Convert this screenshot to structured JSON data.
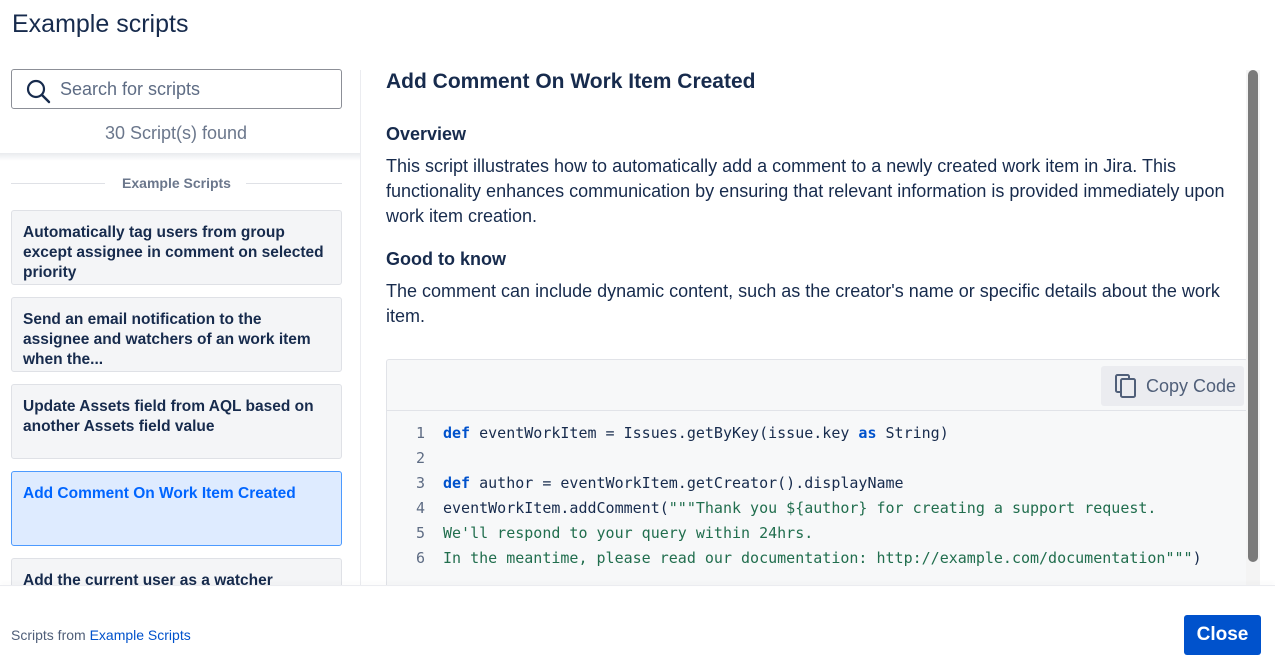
{
  "header": {
    "title": "Example scripts"
  },
  "search": {
    "placeholder": "Search for scripts",
    "value": ""
  },
  "results": {
    "count_text": "30 Script(s) found",
    "section_label": "Example Scripts"
  },
  "scripts": [
    {
      "title": "Automatically tag users from group except assignee in comment on selected priority"
    },
    {
      "title": "Send an email notification to the assignee and watchers of an work item when the..."
    },
    {
      "title": "Update Assets field from AQL based on another Assets field value"
    },
    {
      "title": "Add Comment On Work Item Created"
    },
    {
      "title": "Add the current user as a watcher"
    }
  ],
  "detail": {
    "title": "Add Comment On Work Item Created",
    "overview_heading": "Overview",
    "overview_text": "This script illustrates how to automatically add a comment to a newly created work item in Jira. This functionality enhances communication by ensuring that relevant information is provided immediately upon work item creation.",
    "good_heading": "Good to know",
    "good_text": "The comment can include dynamic content, such as the creator's name or specific details about the work item.",
    "copy_label": "Copy Code",
    "code_lines": [
      {
        "num": "1",
        "kw": "def",
        "text": " eventWorkItem = Issues.getByKey(issue.key ",
        "kw2": "as",
        "text2": " String)"
      },
      {
        "num": "2",
        "text": ""
      },
      {
        "num": "3",
        "kw": "def",
        "text": " author = eventWorkItem.getCreator().displayName"
      },
      {
        "num": "4",
        "text": "eventWorkItem.addComment(",
        "str": "\"\"\"Thank you ${author} for creating a support request."
      },
      {
        "num": "5",
        "str": "We'll respond to your query within 24hrs."
      },
      {
        "num": "6",
        "str": "In the meantime, please read our documentation: http://example.com/documentation\"\"\"",
        "text2": ")"
      }
    ]
  },
  "footer": {
    "prefix": "Scripts from ",
    "link": "Example Scripts",
    "close_label": "Close"
  },
  "colors": {
    "primary": "#0052cc",
    "selected_bg": "#deebff",
    "selected_text": "#0065ff",
    "keyword": "#0052cc",
    "string": "#216e4e"
  },
  "icons": {
    "search": "search-icon",
    "copy": "copy-icon"
  }
}
